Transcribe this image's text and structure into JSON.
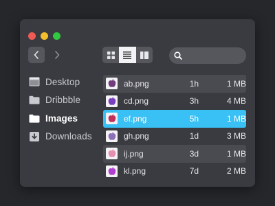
{
  "window": {
    "traffic_lights": {
      "close": "#ef5a52",
      "minimize": "#f3be2d",
      "zoom": "#30c83f"
    }
  },
  "toolbar": {
    "back_icon": "chevron-left-icon",
    "forward_icon": "chevron-right-icon",
    "view_modes": [
      {
        "icon": "grid-view-icon",
        "active": false
      },
      {
        "icon": "list-view-icon",
        "active": true
      },
      {
        "icon": "column-view-icon",
        "active": false
      }
    ],
    "search": {
      "icon": "search-icon",
      "placeholder": ""
    }
  },
  "sidebar": {
    "items": [
      {
        "label": "Desktop",
        "icon": "desktop-icon",
        "active": false
      },
      {
        "label": "Dribbble",
        "icon": "folder-icon",
        "active": false
      },
      {
        "label": "Images",
        "icon": "folder-icon",
        "active": true
      },
      {
        "label": "Downloads",
        "icon": "downloads-icon",
        "active": false
      }
    ]
  },
  "files": [
    {
      "name": "ab.png",
      "age": "1h",
      "size": "1 MB",
      "selected": false
    },
    {
      "name": "cd.png",
      "age": "3h",
      "size": "4 MB",
      "selected": false
    },
    {
      "name": "ef.png",
      "age": "5h",
      "size": "1 MB",
      "selected": true
    },
    {
      "name": "gh.png",
      "age": "1d",
      "size": "3 MB",
      "selected": false
    },
    {
      "name": "ij.png",
      "age": "3d",
      "size": "1 MB",
      "selected": false
    },
    {
      "name": "kl.png",
      "age": "7d",
      "size": "2 MB",
      "selected": false
    }
  ],
  "colors": {
    "accent": "#39c0f4",
    "window_bg": "#3a3b40",
    "control_bg": "#56575d"
  }
}
